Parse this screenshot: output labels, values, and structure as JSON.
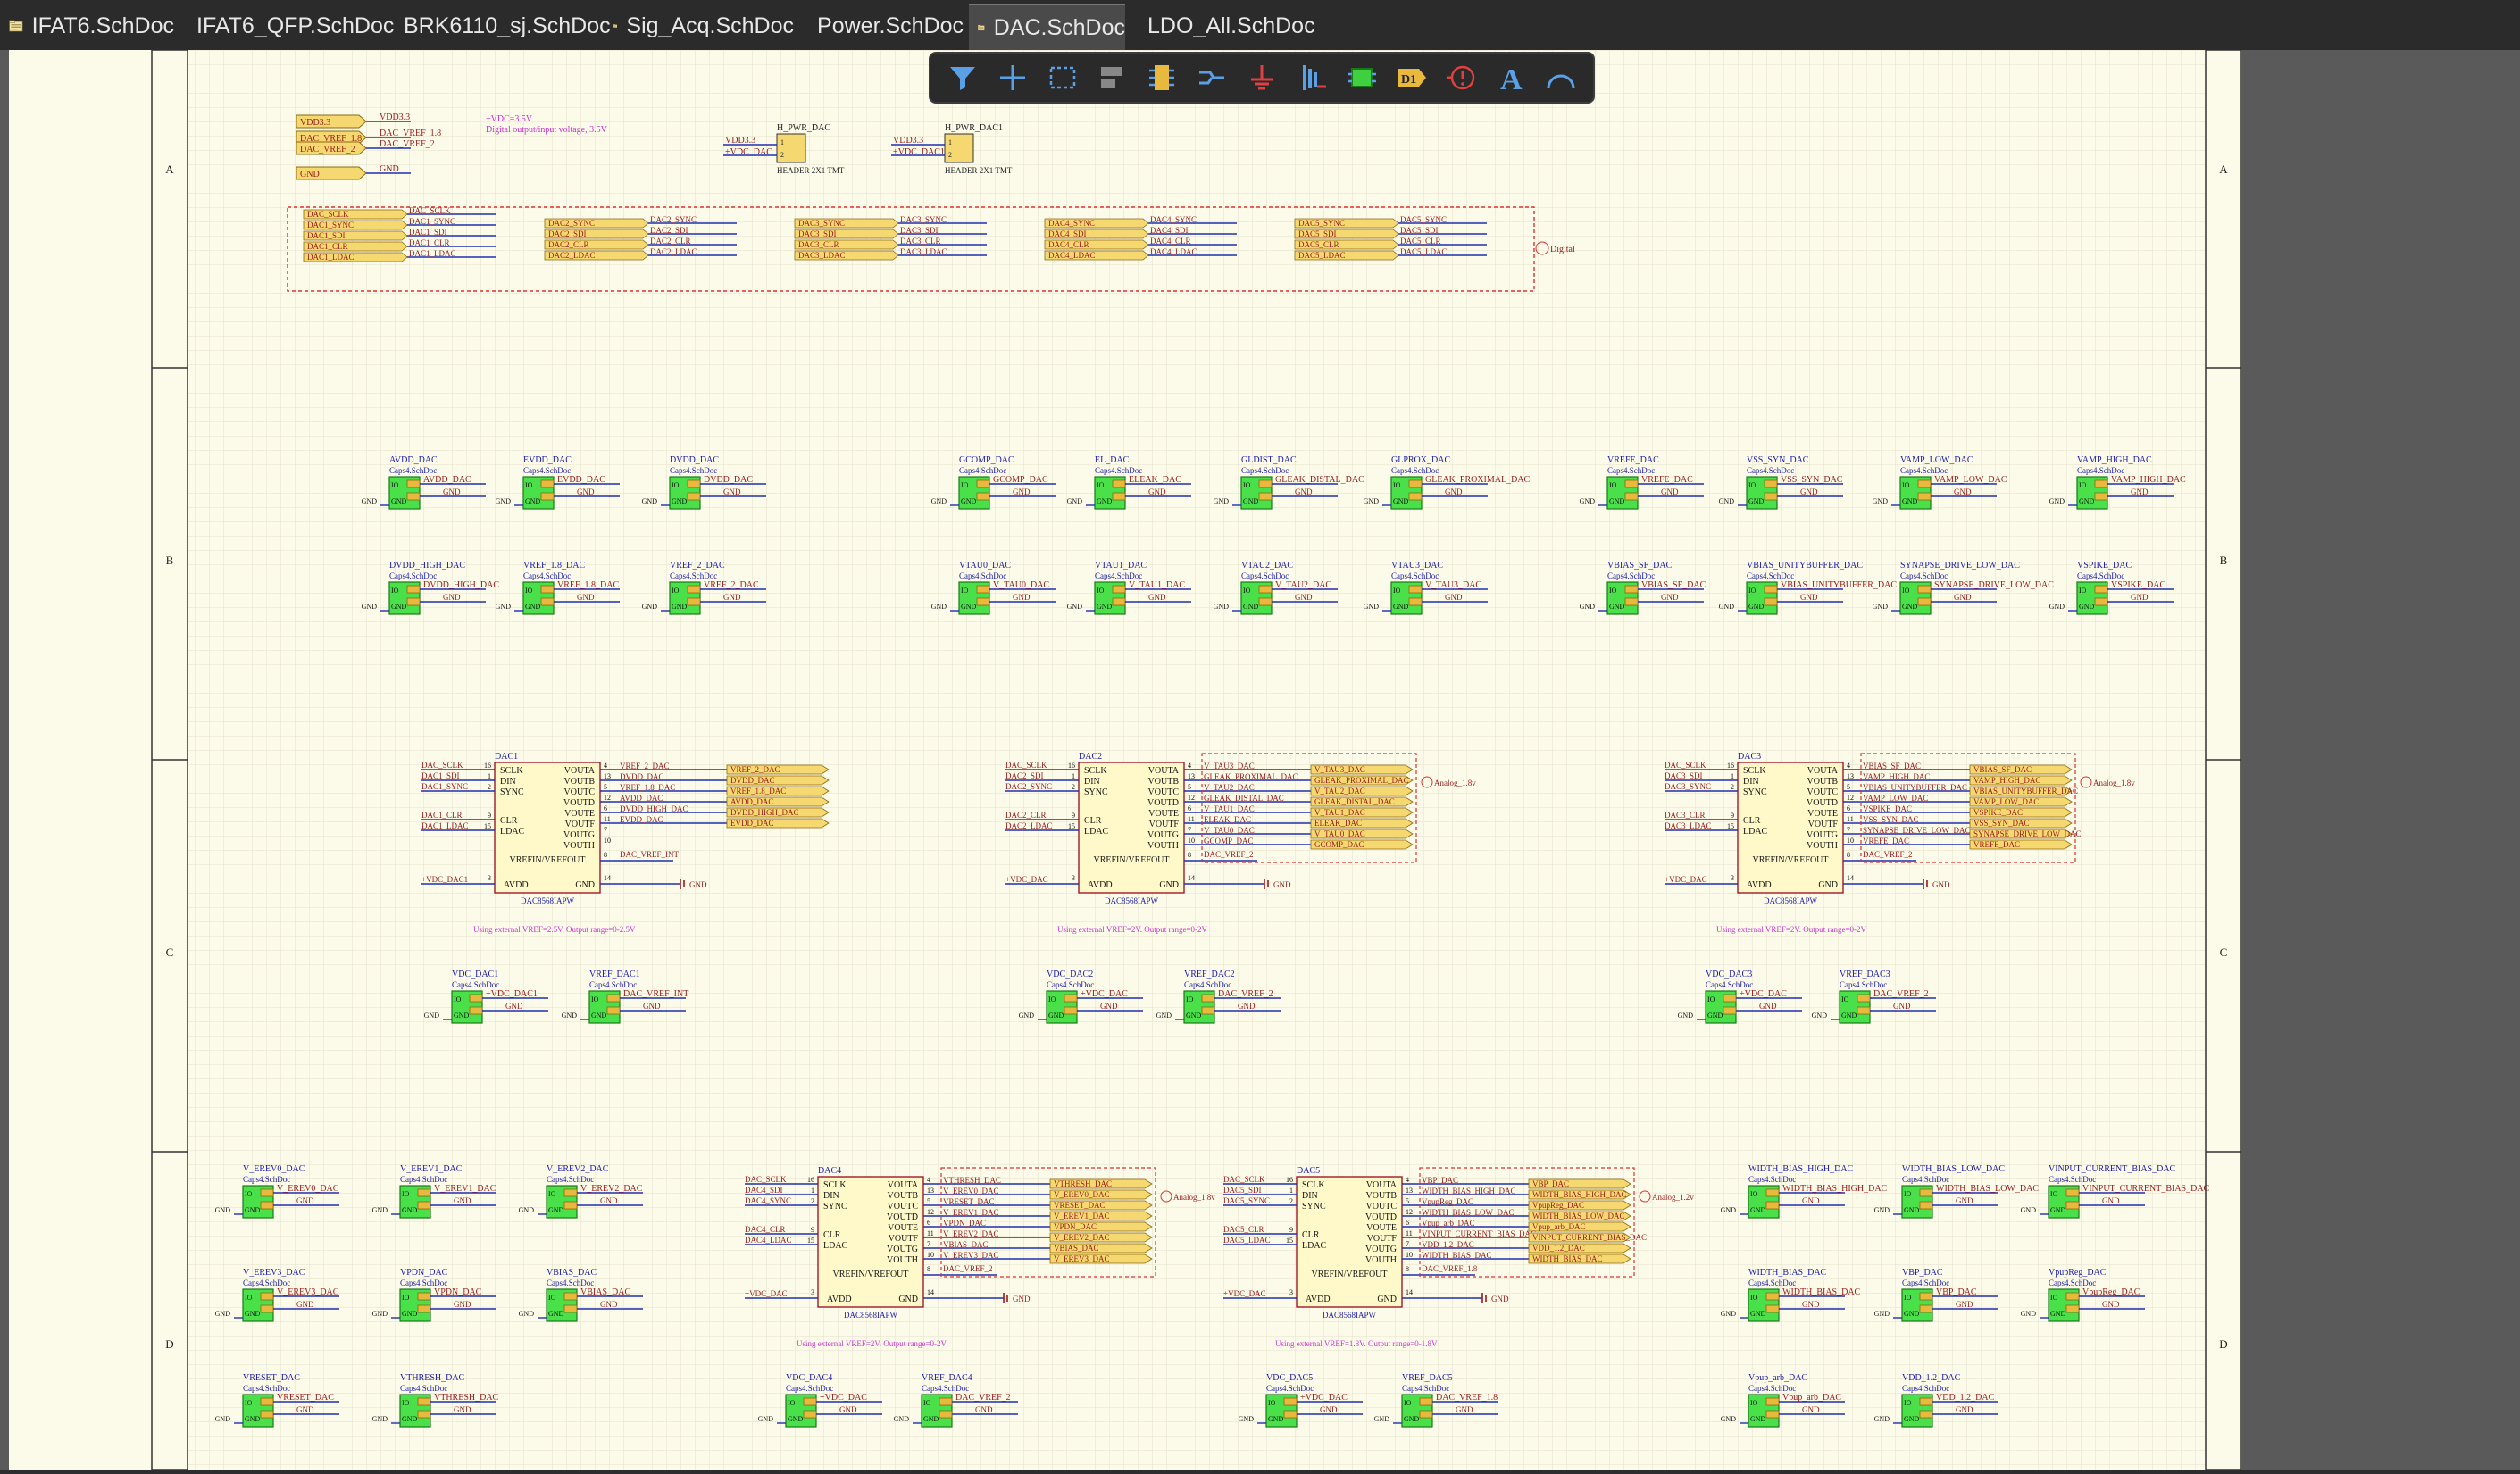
{
  "tabs": [
    {
      "label": "IFAT6.SchDoc",
      "active": false
    },
    {
      "label": "IFAT6_QFP.SchDoc",
      "active": false
    },
    {
      "label": "BRK6110_sj.SchDoc",
      "active": false
    },
    {
      "label": "Sig_Acq.SchDoc",
      "active": false
    },
    {
      "label": "Power.SchDoc",
      "active": false
    },
    {
      "label": "DAC.SchDoc",
      "active": true
    },
    {
      "label": "LDO_All.SchDoc",
      "active": false
    }
  ],
  "toolbar": {
    "buttons": [
      "filter-icon",
      "crosshair-icon",
      "select-rect-icon",
      "align-icon",
      "component-icon",
      "wire-icon",
      "ground-icon",
      "bus-icon",
      "sheet-symbol-icon",
      "net-label-icon",
      "port-icon",
      "text-icon",
      "arc-icon"
    ],
    "port_glyph": "D1",
    "text_glyph": "A"
  },
  "zones": [
    "A",
    "B",
    "C",
    "D"
  ],
  "header": {
    "ports": [
      "VDD3.3",
      "DAC_VREF_1.8",
      "DAC_VREF_2",
      "GND"
    ],
    "nets": [
      "VDD3.3",
      "DAC_VREF_1.8",
      "DAC_VREF_2",
      "GND"
    ],
    "note1": "+VDC=3.5V",
    "note2": "Digital output/input voltage, 3.5V",
    "hdr1": {
      "name": "H_PWR_DAC",
      "nets": [
        "VDD3.3",
        "+VDC_DAC"
      ],
      "footer": "HEADER 2X1 TMT"
    },
    "hdr2": {
      "name": "H_PWR_DAC1",
      "nets": [
        "VDD3.3",
        "+VDC_DAC1"
      ],
      "footer": "HEADER 2X1 TMT"
    }
  },
  "digital_bus": {
    "label": "Digital",
    "groups": [
      {
        "ports": [
          "DAC_SCLK",
          "DAC1_SYNC",
          "DAC1_SDI",
          "DAC1_CLR",
          "DAC1_LDAC"
        ],
        "nets": [
          "DAC_SCLK",
          "DAC1_SYNC",
          "DAC1_SDI",
          "DAC1_CLR",
          "DAC1_LDAC"
        ]
      },
      {
        "ports": [
          "DAC2_SYNC",
          "DAC2_SDI",
          "DAC2_CLR",
          "DAC2_LDAC"
        ],
        "nets": [
          "DAC2_SYNC",
          "DAC2_SDI",
          "DAC2_CLR",
          "DAC2_LDAC"
        ]
      },
      {
        "ports": [
          "DAC3_SYNC",
          "DAC3_SDI",
          "DAC3_CLR",
          "DAC3_LDAC"
        ],
        "nets": [
          "DAC3_SYNC",
          "DAC3_SDI",
          "DAC3_CLR",
          "DAC3_LDAC"
        ]
      },
      {
        "ports": [
          "DAC4_SYNC",
          "DAC4_SDI",
          "DAC4_CLR",
          "DAC4_LDAC"
        ],
        "nets": [
          "DAC4_SYNC",
          "DAC4_SDI",
          "DAC4_CLR",
          "DAC4_LDAC"
        ]
      },
      {
        "ports": [
          "DAC5_SYNC",
          "DAC5_SDI",
          "DAC5_CLR",
          "DAC5_LDAC"
        ],
        "nets": [
          "DAC5_SYNC",
          "DAC5_SDI",
          "DAC5_CLR",
          "DAC5_LDAC"
        ]
      }
    ]
  },
  "caps_row1": [
    {
      "name": "AVDD_DAC",
      "net": "AVDD_DAC"
    },
    {
      "name": "EVDD_DAC",
      "net": "EVDD_DAC"
    },
    {
      "name": "DVDD_DAC",
      "net": "DVDD_DAC"
    },
    {
      "name": "GCOMP_DAC",
      "net": "GCOMP_DAC"
    },
    {
      "name": "EL_DAC",
      "net": "ELEAK_DAC"
    },
    {
      "name": "GLDIST_DAC",
      "net": "GLEAK_DISTAL_DAC"
    },
    {
      "name": "GLPROX_DAC",
      "net": "GLEAK_PROXIMAL_DAC"
    },
    {
      "name": "VREFE_DAC",
      "net": "VREFE_DAC"
    },
    {
      "name": "VSS_SYN_DAC",
      "net": "VSS_SYN_DAC"
    },
    {
      "name": "VAMP_LOW_DAC",
      "net": "VAMP_LOW_DAC"
    },
    {
      "name": "VAMP_HIGH_DAC",
      "net": "VAMP_HIGH_DAC"
    }
  ],
  "caps_row2": [
    {
      "name": "DVDD_HIGH_DAC",
      "net": "DVDD_HIGH_DAC"
    },
    {
      "name": "VREF_1.8_DAC",
      "net": "VREF_1.8_DAC"
    },
    {
      "name": "VREF_2_DAC",
      "net": "VREF_2_DAC"
    },
    {
      "name": "VTAU0_DAC",
      "net": "V_TAU0_DAC"
    },
    {
      "name": "VTAU1_DAC",
      "net": "V_TAU1_DAC"
    },
    {
      "name": "VTAU2_DAC",
      "net": "V_TAU2_DAC"
    },
    {
      "name": "VTAU3_DAC",
      "net": "V_TAU3_DAC"
    },
    {
      "name": "VBIAS_SF_DAC",
      "net": "VBIAS_SF_DAC"
    },
    {
      "name": "VBIAS_UNITYBUFFER_DAC",
      "net": "VBIAS_UNITYBUFFER_DAC"
    },
    {
      "name": "SYNAPSE_DRIVE_LOW_DAC",
      "net": "SYNAPSE_DRIVE_LOW_DAC"
    },
    {
      "name": "VSPIKE_DAC",
      "net": "VSPIKE_DAC"
    }
  ],
  "caps_mid": [
    {
      "name": "VDC_DAC1",
      "net": "+VDC_DAC1"
    },
    {
      "name": "VREF_DAC1",
      "net": "DAC_VREF_INT"
    },
    {
      "name": "VDC_DAC2",
      "net": "+VDC_DAC"
    },
    {
      "name": "VREF_DAC2",
      "net": "DAC_VREF_2"
    },
    {
      "name": "VDC_DAC3",
      "net": "+VDC_DAC"
    },
    {
      "name": "VREF_DAC3",
      "net": "DAC_VREF_2"
    }
  ],
  "caps_d1": [
    {
      "name": "V_EREV0_DAC",
      "net": "V_EREV0_DAC"
    },
    {
      "name": "V_EREV1_DAC",
      "net": "V_EREV1_DAC"
    },
    {
      "name": "V_EREV2_DAC",
      "net": "V_EREV2_DAC"
    },
    {
      "name": "WIDTH_BIAS_HIGH_DAC",
      "net": "WIDTH_BIAS_HIGH_DAC"
    },
    {
      "name": "WIDTH_BIAS_LOW_DAC",
      "net": "WIDTH_BIAS_LOW_DAC"
    },
    {
      "name": "VINPUT_CURRENT_BIAS_DAC",
      "net": "VINPUT_CURRENT_BIAS_DAC"
    }
  ],
  "caps_d2": [
    {
      "name": "V_EREV3_DAC",
      "net": "V_EREV3_DAC"
    },
    {
      "name": "VPDN_DAC",
      "net": "VPDN_DAC"
    },
    {
      "name": "VBIAS_DAC",
      "net": "VBIAS_DAC"
    },
    {
      "name": "WIDTH_BIAS_DAC",
      "net": "WIDTH_BIAS_DAC"
    },
    {
      "name": "VBP_DAC",
      "net": "VBP_DAC"
    },
    {
      "name": "VpupReg_DAC",
      "net": "VpupReg_DAC"
    }
  ],
  "caps_d3": [
    {
      "name": "VRESET_DAC",
      "net": "VRESET_DAC"
    },
    {
      "name": "VTHRESH_DAC",
      "net": "VTHRESH_DAC"
    },
    {
      "name": "VDC_DAC4",
      "net": "+VDC_DAC"
    },
    {
      "name": "VREF_DAC4",
      "net": "DAC_VREF_2"
    },
    {
      "name": "VDC_DAC5",
      "net": "+VDC_DAC"
    },
    {
      "name": "VREF_DAC5",
      "net": "DAC_VREF_1.8"
    },
    {
      "name": "Vpup_arb_DAC",
      "net": "Vpup_arb_DAC"
    },
    {
      "name": "VDD_1.2_DAC",
      "net": "VDD_1.2_DAC"
    }
  ],
  "cap_footprint": "Caps4.SchDoc",
  "cap_pins": [
    "IO",
    "GND",
    "GND"
  ],
  "dac_pins": {
    "in_names": [
      "SCLK",
      "DIN",
      "SYNC",
      "CLR",
      "LDAC"
    ],
    "in_nums": [
      "16",
      "1",
      "2",
      "9",
      "15"
    ],
    "out_names": [
      "VOUTA",
      "VOUTB",
      "VOUTC",
      "VOUTD",
      "VOUTE",
      "VOUTF",
      "VOUTG",
      "VOUTH"
    ],
    "out_nums": [
      "4",
      "13",
      "5",
      "12",
      "6",
      "11",
      "7",
      "10"
    ],
    "vref_name": "VREFIN/VREFOUT",
    "vref_num": "8",
    "avdd": "AVDD",
    "gnd": "GND",
    "avdd_num": "3",
    "gnd_num": "14",
    "part": "DAC8568IAPW"
  },
  "dacs": [
    {
      "name": "DAC1",
      "ins": [
        "DAC_SCLK",
        "DAC1_SDI",
        "DAC1_SYNC",
        "DAC1_CLR",
        "DAC1_LDAC"
      ],
      "outs": [
        "VREF_2_DAC",
        "DVDD_DAC",
        "VREF_1.8_DAC",
        "AVDD_DAC",
        "DVDD_HIGH_DAC",
        "EVDD_DAC"
      ],
      "ports": [
        "VREF_2_DAC",
        "DVDD_DAC",
        "VREF_1.8_DAC",
        "AVDD_DAC",
        "DVDD_HIGH_DAC",
        "EVDD_DAC"
      ],
      "vref": "DAC_VREF_INT",
      "vdc": "+VDC_DAC1",
      "note": "Using external VREF=2.5V. Output range=0-2.5V",
      "group": ""
    },
    {
      "name": "DAC2",
      "ins": [
        "DAC_SCLK",
        "DAC2_SDI",
        "DAC2_SYNC",
        "DAC2_CLR",
        "DAC2_LDAC"
      ],
      "outs": [
        "V_TAU3_DAC",
        "GLEAK_PROXIMAL_DAC",
        "V_TAU2_DAC",
        "GLEAK_DISTAL_DAC",
        "V_TAU1_DAC",
        "ELEAK_DAC",
        "V_TAU0_DAC",
        "GCOMP_DAC"
      ],
      "ports": [
        "V_TAU3_DAC",
        "GLEAK_PROXIMAL_DAC",
        "V_TAU2_DAC",
        "GLEAK_DISTAL_DAC",
        "V_TAU1_DAC",
        "ELEAK_DAC",
        "V_TAU0_DAC",
        "GCOMP_DAC"
      ],
      "vref": "DAC_VREF_2",
      "vdc": "+VDC_DAC",
      "note": "Using external VREF=2V. Output range=0-2V",
      "group": "Analog_1.8v"
    },
    {
      "name": "DAC3",
      "ins": [
        "DAC_SCLK",
        "DAC3_SDI",
        "DAC3_SYNC",
        "DAC3_CLR",
        "DAC3_LDAC"
      ],
      "outs": [
        "VBIAS_SF_DAC",
        "VAMP_HIGH_DAC",
        "VBIAS_UNITYBUFFER_DAC",
        "VAMP_LOW_DAC",
        "VSPIKE_DAC",
        "VSS_SYN_DAC",
        "SYNAPSE_DRIVE_LOW_DAC",
        "VREFE_DAC"
      ],
      "ports": [
        "VBIAS_SF_DAC",
        "VAMP_HIGH_DAC",
        "VBIAS_UNITYBUFFER_DAC",
        "VAMP_LOW_DAC",
        "VSPIKE_DAC",
        "VSS_SYN_DAC",
        "SYNAPSE_DRIVE_LOW_DAC",
        "VREFE_DAC"
      ],
      "vref": "DAC_VREF_2",
      "vdc": "+VDC_DAC",
      "note": "Using external VREF=2V. Output range=0-2V",
      "group": "Analog_1.8v"
    },
    {
      "name": "DAC4",
      "ins": [
        "DAC_SCLK",
        "DAC4_SDI",
        "DAC4_SYNC",
        "DAC4_CLR",
        "DAC4_LDAC"
      ],
      "outs": [
        "VTHRESH_DAC",
        "V_EREV0_DAC",
        "VRESET_DAC",
        "V_EREV1_DAC",
        "VPDN_DAC",
        "V_EREV2_DAC",
        "VBIAS_DAC",
        "V_EREV3_DAC"
      ],
      "ports": [
        "VTHRESH_DAC",
        "V_EREV0_DAC",
        "VRESET_DAC",
        "V_EREV1_DAC",
        "VPDN_DAC",
        "V_EREV2_DAC",
        "VBIAS_DAC",
        "V_EREV3_DAC"
      ],
      "vref": "DAC_VREF_2",
      "vdc": "+VDC_DAC",
      "note": "Using external VREF=2V. Output range=0-2V",
      "group": "Analog_1.8v"
    },
    {
      "name": "DAC5",
      "ins": [
        "DAC_SCLK",
        "DAC5_SDI",
        "DAC5_SYNC",
        "DAC5_CLR",
        "DAC5_LDAC"
      ],
      "outs": [
        "VBP_DAC",
        "WIDTH_BIAS_HIGH_DAC",
        "VpupReg_DAC",
        "WIDTH_BIAS_LOW_DAC",
        "Vpup_arb_DAC",
        "VINPUT_CURRENT_BIAS_DAC",
        "VDD_1.2_DAC",
        "WIDTH_BIAS_DAC"
      ],
      "ports": [
        "VBP_DAC",
        "WIDTH_BIAS_HIGH_DAC",
        "VpupReg_DAC",
        "WIDTH_BIAS_LOW_DAC",
        "Vpup_arb_DAC",
        "VINPUT_CURRENT_BIAS_DAC",
        "VDD_1.2_DAC",
        "WIDTH_BIAS_DAC"
      ],
      "vref": "DAC_VREF_1.8",
      "vdc": "+VDC_DAC",
      "note": "Using external VREF=1.8V. Output range=0-1.8V",
      "group": "Analog_1.2v"
    }
  ],
  "gnd_label": "GND",
  "colors": {
    "sheet": "#fcfbe9",
    "wire": "#1f2fae",
    "netlabel": "#9a1a1a",
    "port": "#f6d870",
    "cap": "#49e049",
    "note": "#cc33cc",
    "zone": "#cc2222",
    "pinname": "#151515"
  }
}
